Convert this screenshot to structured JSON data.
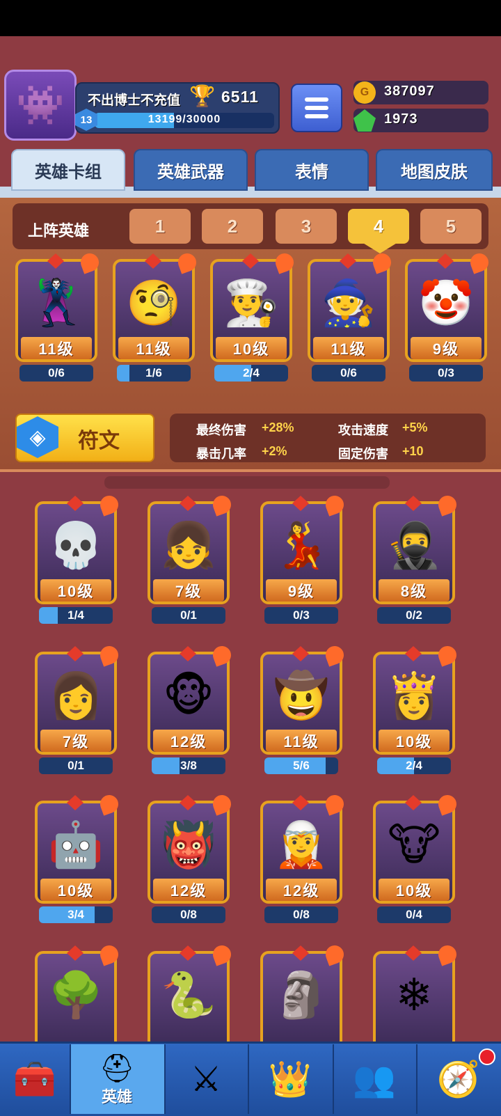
{
  "player": {
    "name": "不出博士不充值",
    "trophies": "6511",
    "level": "13",
    "xp_text": "13199/30000",
    "xp_fraction": 0.44
  },
  "currencies": {
    "gold": "387097",
    "gems": "1973"
  },
  "tabs": [
    "英雄卡组",
    "英雄武器",
    "表情",
    "地图皮肤"
  ],
  "squad": {
    "label": "上阵英雄",
    "slots": [
      "1",
      "2",
      "3",
      "4",
      "5"
    ],
    "active_slot": "4"
  },
  "lineup": [
    {
      "level": "11级",
      "progress": "0/6",
      "fill": 0.0,
      "icon": "pharaoh-hero"
    },
    {
      "level": "11级",
      "progress": "1/6",
      "fill": 0.17,
      "icon": "monocle-hero"
    },
    {
      "level": "10级",
      "progress": "2/4",
      "fill": 0.5,
      "icon": "mustache-chef-hero"
    },
    {
      "level": "11级",
      "progress": "0/6",
      "fill": 0.0,
      "icon": "dark-wizard-hero"
    },
    {
      "level": "9级",
      "progress": "0/3",
      "fill": 0.0,
      "icon": "clown-hero"
    }
  ],
  "rune": {
    "label": "符文",
    "stats": [
      {
        "name": "最终伤害",
        "value": "+28%"
      },
      {
        "name": "攻击速度",
        "value": "+5%"
      },
      {
        "name": "暴击几率",
        "value": "+2%"
      },
      {
        "name": "固定伤害",
        "value": "+10"
      }
    ]
  },
  "collection": [
    {
      "level": "10级",
      "progress": "1/4",
      "fill": 0.25,
      "icon": "skull-hero"
    },
    {
      "level": "7级",
      "progress": "0/1",
      "fill": 0.0,
      "icon": "silver-hair-girl-hero"
    },
    {
      "level": "9级",
      "progress": "0/3",
      "fill": 0.0,
      "icon": "purple-hair-hero"
    },
    {
      "level": "8级",
      "progress": "0/2",
      "fill": 0.0,
      "icon": "hooded-ninja-hero"
    },
    {
      "level": "7级",
      "progress": "0/1",
      "fill": 0.0,
      "icon": "brown-hair-girl-hero"
    },
    {
      "level": "12级",
      "progress": "3/8",
      "fill": 0.375,
      "icon": "monkey-king-hero"
    },
    {
      "level": "11级",
      "progress": "5/6",
      "fill": 0.83,
      "icon": "gunner-hero"
    },
    {
      "level": "10级",
      "progress": "2/4",
      "fill": 0.5,
      "icon": "fan-girl-hero"
    },
    {
      "level": "10级",
      "progress": "3/4",
      "fill": 0.75,
      "icon": "armored-knight-hero"
    },
    {
      "level": "12级",
      "progress": "0/8",
      "fill": 0.0,
      "icon": "lava-golem-hero"
    },
    {
      "level": "12级",
      "progress": "0/8",
      "fill": 0.0,
      "icon": "blue-hair-girl-hero"
    },
    {
      "level": "10级",
      "progress": "0/4",
      "fill": 0.0,
      "icon": "bull-warrior-hero"
    },
    {
      "icon": "tree-hero"
    },
    {
      "icon": "medusa-hero"
    },
    {
      "icon": "stone-giant-hero"
    },
    {
      "icon": "yeti-hero"
    }
  ],
  "nav": [
    {
      "icon": "treasure-chest-icon"
    },
    {
      "icon": "knight-helmet-icon",
      "label": "英雄"
    },
    {
      "icon": "crossed-swords-icon"
    },
    {
      "icon": "crown-shield-icon"
    },
    {
      "icon": "team-icon"
    },
    {
      "icon": "compass-icon"
    }
  ],
  "colors": {
    "background": "#8e3b42",
    "tab_blue": "#3b6bb4",
    "gold_accent": "#f5c23a"
  }
}
